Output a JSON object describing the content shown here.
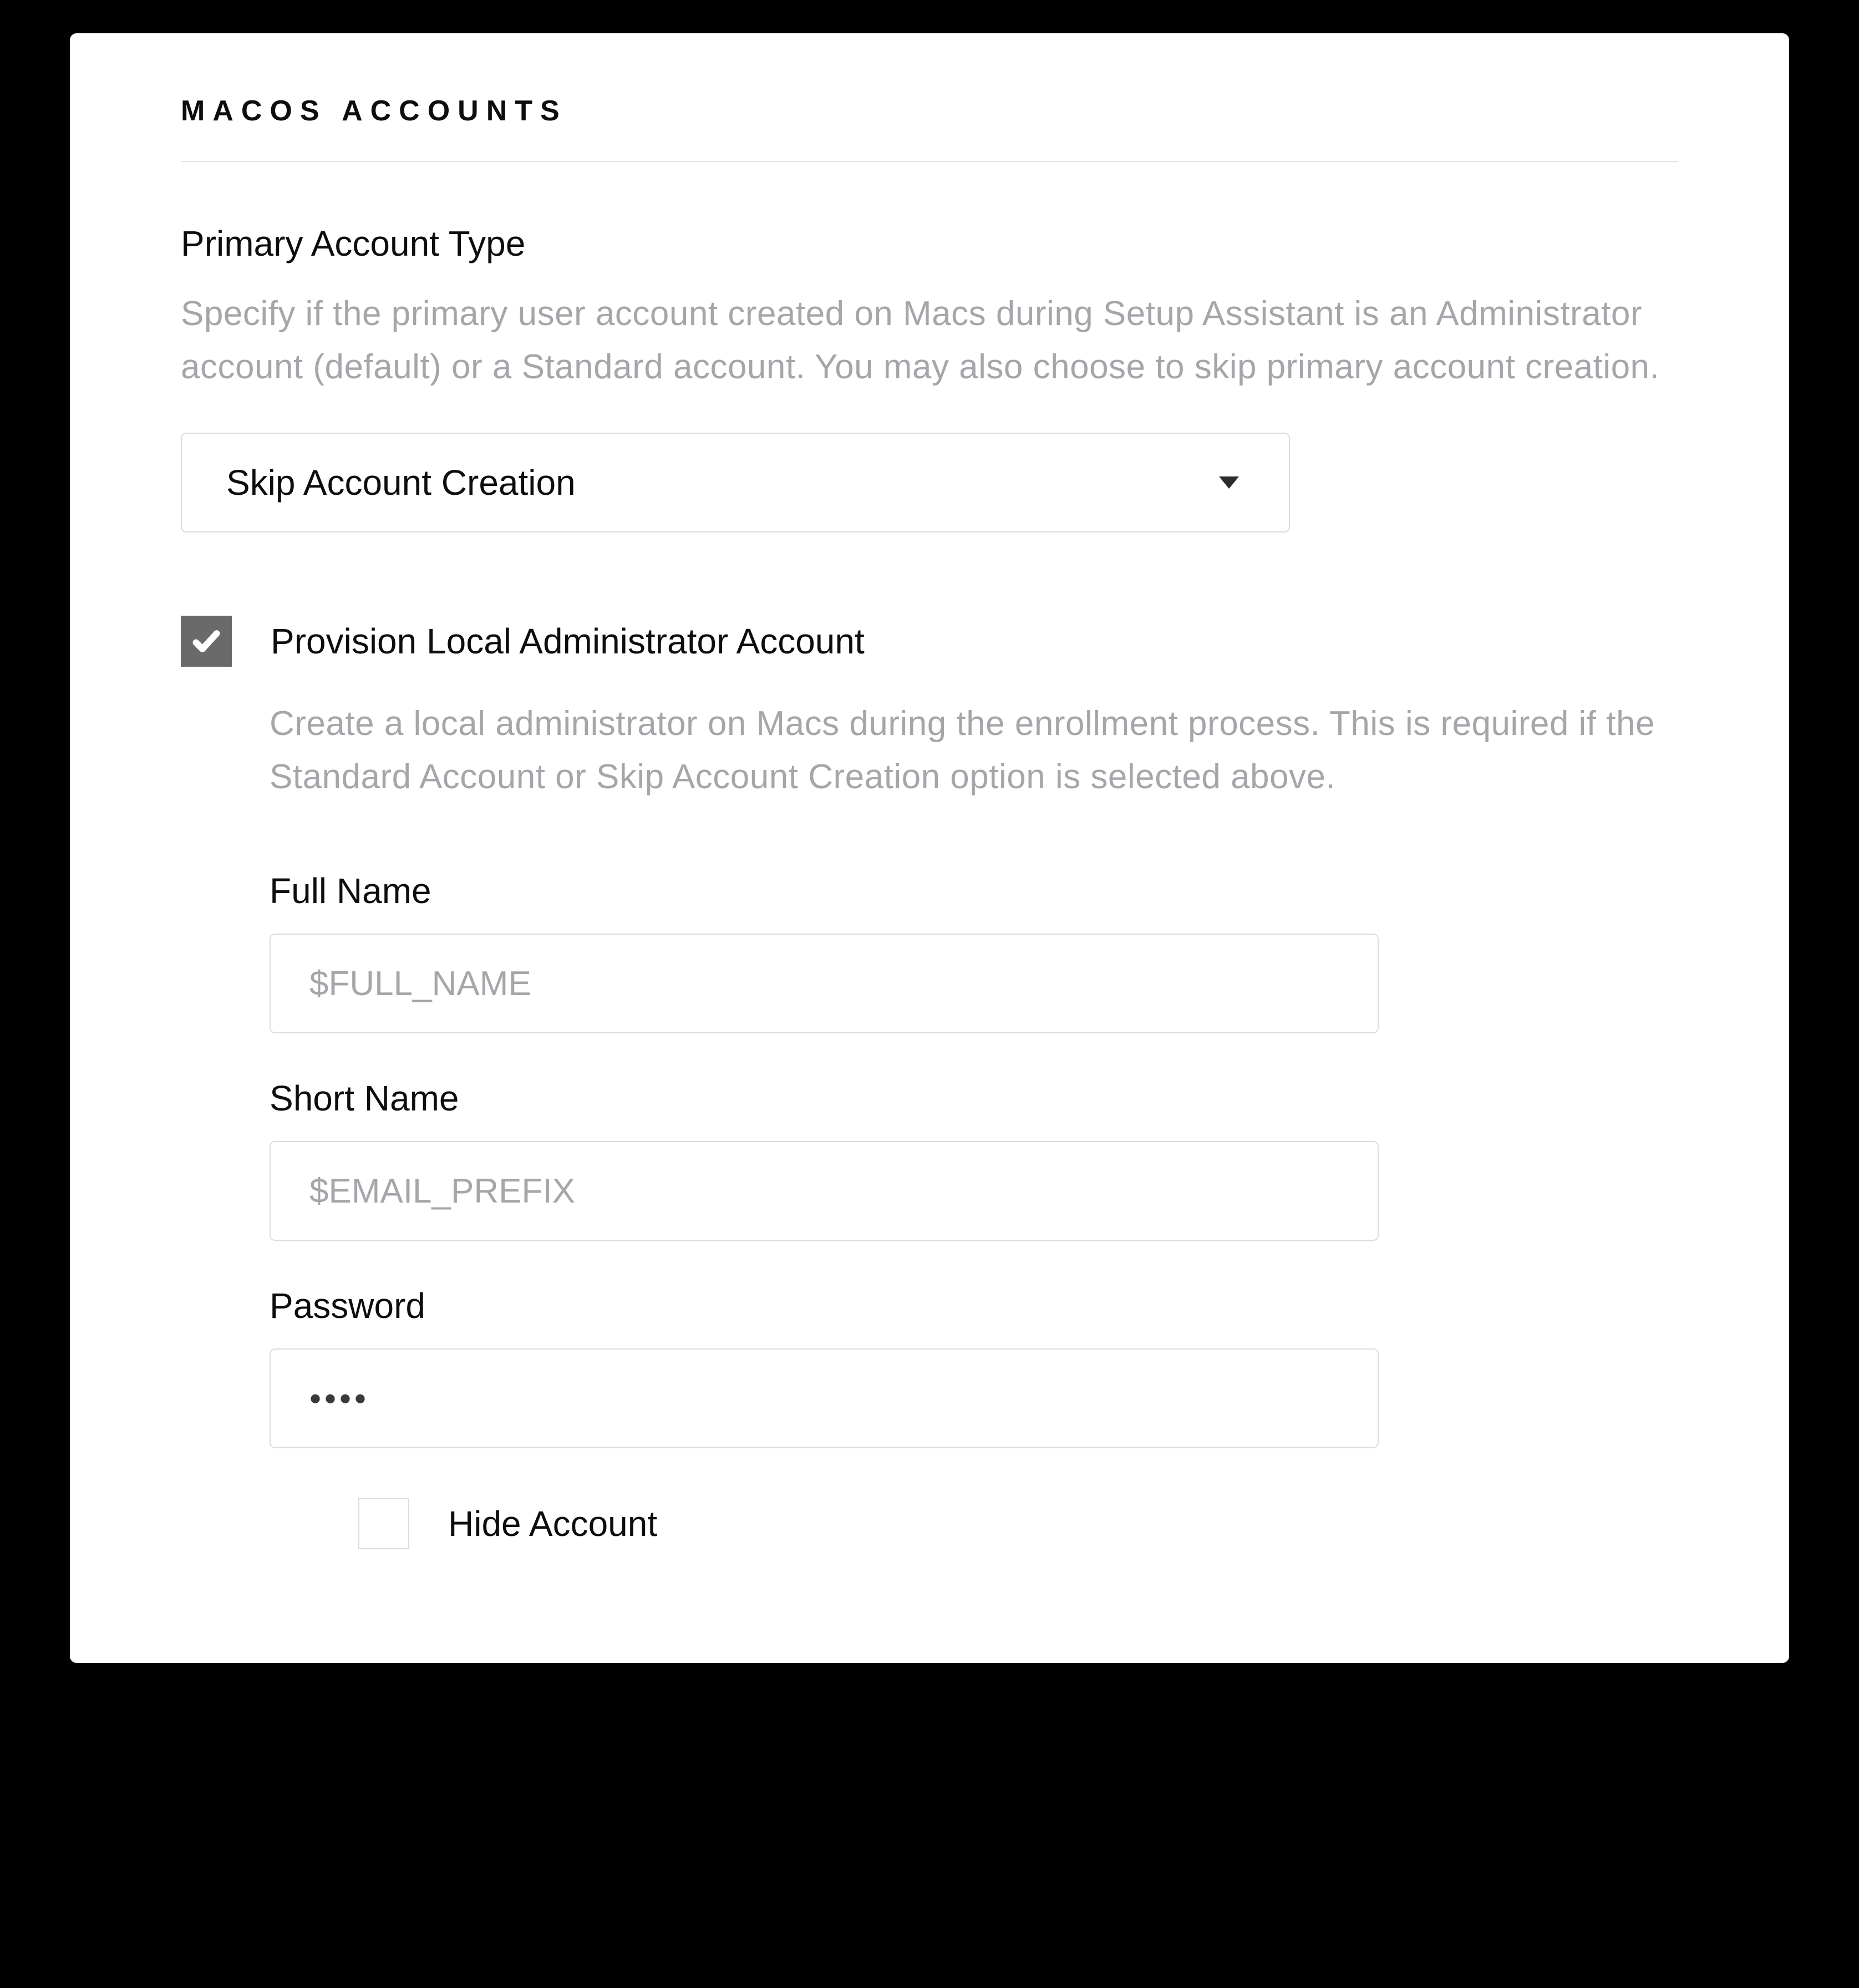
{
  "header": "MACOS ACCOUNTS",
  "primary": {
    "title": "Primary Account Type",
    "desc": "Specify if the primary user account created on Macs during Setup Assistant is an Administrator account (default) or a Standard account. You may also choose to skip primary account creation.",
    "select_value": "Skip Account Creation"
  },
  "provision": {
    "checkbox_label": "Provision Local Administrator Account",
    "checked": true,
    "desc": "Create a local administrator on Macs during the enrollment process. This is required if the Standard Account or Skip Account Creation option is selected above.",
    "fields": {
      "full_name": {
        "label": "Full Name",
        "value": "$FULL_NAME"
      },
      "short_name": {
        "label": "Short Name",
        "value": "$EMAIL_PREFIX"
      },
      "password": {
        "label": "Password",
        "value": "••••"
      }
    },
    "hide": {
      "label": "Hide Account",
      "checked": false
    }
  }
}
